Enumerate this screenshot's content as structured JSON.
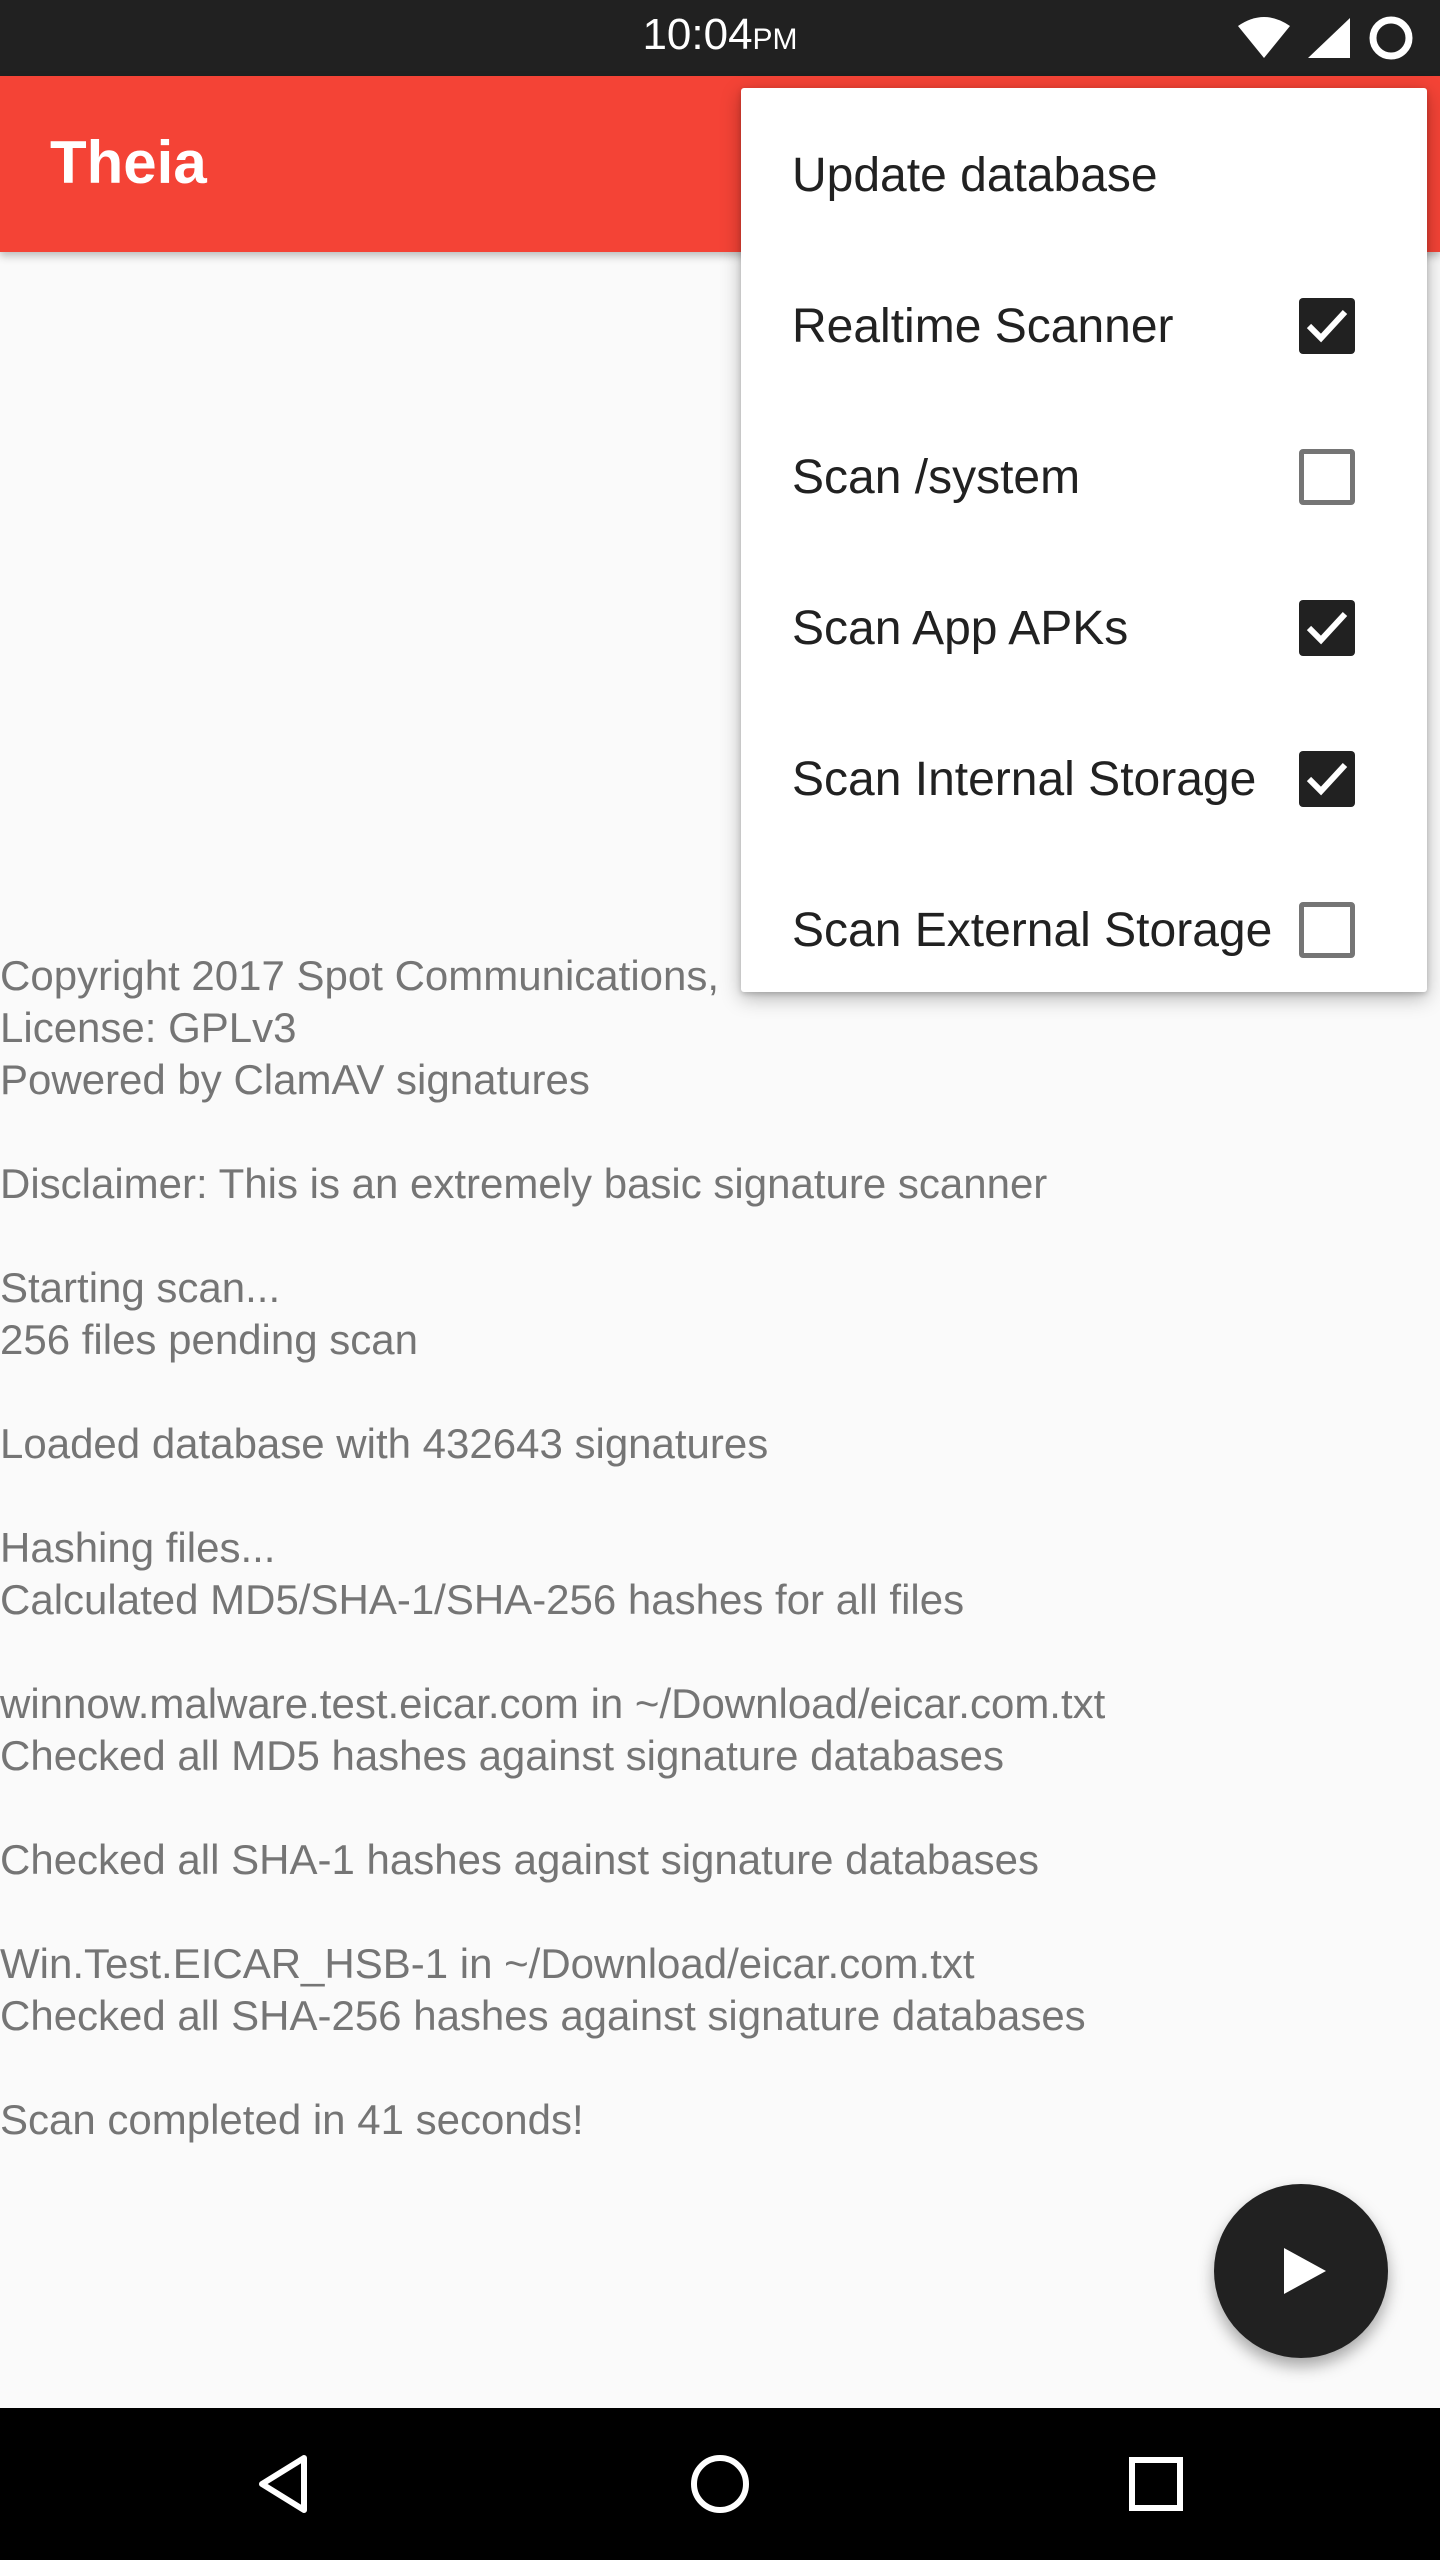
{
  "status_bar": {
    "time": "10:04",
    "ampm": "PM",
    "icons": [
      "wifi-icon",
      "signal-icon",
      "sync-icon"
    ]
  },
  "app_bar": {
    "title": "Theia",
    "color": "#f44336"
  },
  "menu": {
    "items": [
      {
        "label": "Update database",
        "checkable": false
      },
      {
        "label": "Realtime Scanner",
        "checkable": true,
        "checked": true
      },
      {
        "label": "Scan /system",
        "checkable": true,
        "checked": false
      },
      {
        "label": "Scan App APKs",
        "checkable": true,
        "checked": true
      },
      {
        "label": "Scan Internal Storage",
        "checkable": true,
        "checked": true
      },
      {
        "label": "Scan External Storage",
        "checkable": true,
        "checked": false
      }
    ]
  },
  "log": {
    "lines": [
      "Copyright 2017 Spot Communications,",
      "License: GPLv3",
      "Powered by ClamAV signatures",
      "",
      "Disclaimer: This is an extremely basic signature scanner",
      "",
      "Starting scan...",
      "256 files pending scan",
      "",
      "Loaded database with 432643 signatures",
      "",
      "Hashing files...",
      "Calculated MD5/SHA-1/SHA-256 hashes for all files",
      "",
      "winnow.malware.test.eicar.com in ~/Download/eicar.com.txt",
      "Checked all MD5 hashes against signature databases",
      "",
      "Checked all SHA-1 hashes against signature databases",
      "",
      "Win.Test.EICAR_HSB-1 in ~/Download/eicar.com.txt",
      "Checked all SHA-256 hashes against signature databases",
      "",
      "Scan completed in 41 seconds!"
    ]
  },
  "fab": {
    "icon": "play-icon"
  },
  "nav_bar": {
    "icons": [
      "back-icon",
      "home-icon",
      "recents-icon"
    ]
  }
}
